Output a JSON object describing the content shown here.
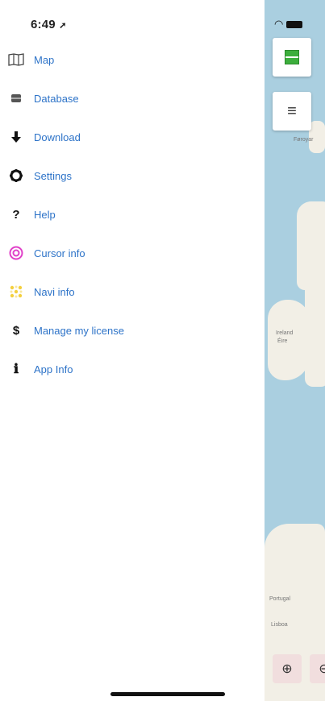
{
  "status": {
    "time": "6:49",
    "location_icon": "location-arrow-icon",
    "wifi_icon": "wifi-icon",
    "battery_icon": "battery-icon"
  },
  "menu": {
    "items": [
      {
        "label": "Map",
        "icon": "map-icon"
      },
      {
        "label": "Database",
        "icon": "database-icon"
      },
      {
        "label": "Download",
        "icon": "download-arrow-icon"
      },
      {
        "label": "Settings",
        "icon": "gear-icon"
      },
      {
        "label": "Help",
        "icon": "question-icon"
      },
      {
        "label": "Cursor info",
        "icon": "target-icon"
      },
      {
        "label": "Navi info",
        "icon": "navi-icon"
      },
      {
        "label": "Manage my license",
        "icon": "dollar-icon"
      },
      {
        "label": "App Info",
        "icon": "info-icon"
      }
    ]
  },
  "map": {
    "layers_button_icon": "layers-icon",
    "menu_button_icon": "hamburger-menu-icon",
    "zoom_in_icon": "zoom-in-icon",
    "zoom_out_icon": "zoom-out-icon",
    "labels": {
      "faroe": "Føroyar",
      "ireland": "Éire",
      "ireland2": "Ireland",
      "portugal": "Portugal",
      "lisboa": "Lisboa"
    }
  }
}
